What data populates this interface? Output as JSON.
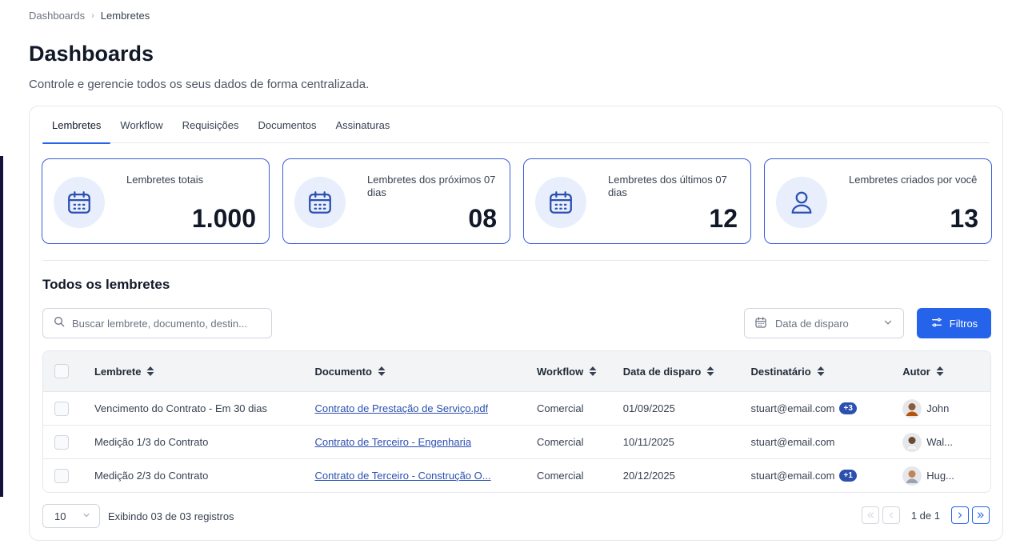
{
  "breadcrumb": {
    "root": "Dashboards",
    "current": "Lembretes"
  },
  "header": {
    "title": "Dashboards",
    "subtitle": "Controle e gerencie todos os seus dados de forma centralizada."
  },
  "tabs": [
    {
      "label": "Lembretes",
      "active": true
    },
    {
      "label": "Workflow",
      "active": false
    },
    {
      "label": "Requisições",
      "active": false
    },
    {
      "label": "Documentos",
      "active": false
    },
    {
      "label": "Assinaturas",
      "active": false
    }
  ],
  "stats": [
    {
      "label": "Lembretes totais",
      "value": "1.000",
      "icon": "calendar-icon"
    },
    {
      "label": "Lembretes dos próximos 07 dias",
      "value": "08",
      "icon": "calendar-icon"
    },
    {
      "label": "Lembretes dos últimos 07 dias",
      "value": "12",
      "icon": "calendar-icon"
    },
    {
      "label": "Lembretes criados por você",
      "value": "13",
      "icon": "user-icon"
    }
  ],
  "section": {
    "title": "Todos os lembretes"
  },
  "search": {
    "placeholder": "Buscar lembrete, documento, destin...",
    "value": ""
  },
  "date_filter": {
    "label": "Data de disparo"
  },
  "filter_button": {
    "label": "Filtros"
  },
  "table": {
    "columns": [
      "Lembrete",
      "Documento",
      "Workflow",
      "Data de disparo",
      "Destinatário",
      "Autor"
    ],
    "rows": [
      {
        "lembrete": "Vencimento do Contrato - Em 30 dias",
        "documento": "Contrato de Prestação de Serviço.pdf",
        "workflow": "Comercial",
        "data": "01/09/2025",
        "destinatario": "stuart@email.com",
        "extra": "+3",
        "autor": "John"
      },
      {
        "lembrete": "Medição 1/3 do Contrato",
        "documento": "Contrato de Terceiro - Engenharia",
        "workflow": "Comercial",
        "data": "10/11/2025",
        "destinatario": "stuart@email.com",
        "extra": "",
        "autor": "Wal..."
      },
      {
        "lembrete": "Medição 2/3 do Contrato",
        "documento": "Contrato de Terceiro - Construção O...",
        "workflow": "Comercial",
        "data": "20/12/2025",
        "destinatario": "stuart@email.com",
        "extra": "+1",
        "autor": "Hug..."
      }
    ]
  },
  "footer": {
    "per_page": "10",
    "records_text": "Exibindo 03 de 03 registros",
    "page_text": "1 de 1"
  },
  "colors": {
    "accent": "#2563eb",
    "link": "#2b50b0",
    "card_border": "#3b5bdb",
    "icon_bg": "#e8eefc"
  }
}
